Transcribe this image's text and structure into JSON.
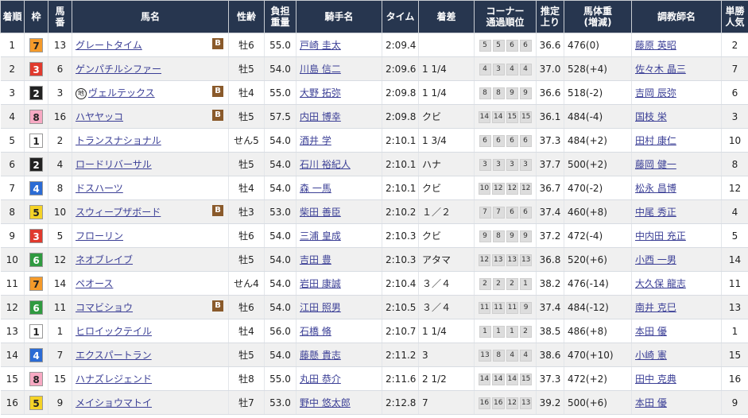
{
  "headers": {
    "rank": "着順",
    "waku": "枠",
    "umaban": "馬\n番",
    "horse": "馬名",
    "sexage": "性齢",
    "kinryo": "負担\n重量",
    "jockey": "騎手名",
    "time": "タイム",
    "margin": "着差",
    "corner": "コーナー\n通過順位",
    "last3f": "推定\n上り",
    "weight": "馬体重\n(増減)",
    "trainer": "調教師名",
    "pop": "単勝\n人気"
  },
  "waku_colors": {
    "1": {
      "bg": "#ffffff",
      "fg": "#222222"
    },
    "2": {
      "bg": "#222222",
      "fg": "#ffffff"
    },
    "3": {
      "bg": "#e03a2e",
      "fg": "#ffffff"
    },
    "4": {
      "bg": "#2b6bd4",
      "fg": "#ffffff"
    },
    "5": {
      "bg": "#f5d327",
      "fg": "#222222"
    },
    "6": {
      "bg": "#2f9a40",
      "fg": "#ffffff"
    },
    "7": {
      "bg": "#f49a2a",
      "fg": "#222222"
    },
    "8": {
      "bg": "#f7a9c3",
      "fg": "#222222"
    }
  },
  "blinker_label": "B",
  "mark_label": "地",
  "rows": [
    {
      "rank": "1",
      "waku": "7",
      "umaban": "13",
      "horse": "グレートタイム",
      "blinker": true,
      "mark": false,
      "sexage": "牡6",
      "kinryo": "55.0",
      "jockey": "戸崎 圭太",
      "time": "2:09.4",
      "margin": "",
      "corner": [
        "5",
        "5",
        "6",
        "6"
      ],
      "last3f": "36.6",
      "weight": "476(0)",
      "trainer": "藤原 英昭",
      "pop": "2"
    },
    {
      "rank": "2",
      "waku": "3",
      "umaban": "6",
      "horse": "ゲンパチルシファー",
      "blinker": false,
      "mark": false,
      "sexage": "牡5",
      "kinryo": "54.0",
      "jockey": "川島 信二",
      "time": "2:09.6",
      "margin": "1 1/4",
      "corner": [
        "4",
        "3",
        "4",
        "4"
      ],
      "last3f": "37.0",
      "weight": "528(+4)",
      "trainer": "佐々木 晶三",
      "pop": "7"
    },
    {
      "rank": "3",
      "waku": "2",
      "umaban": "3",
      "horse": "ヴェルテックス",
      "blinker": true,
      "mark": true,
      "sexage": "牡4",
      "kinryo": "55.0",
      "jockey": "大野 拓弥",
      "time": "2:09.8",
      "margin": "1 1/4",
      "corner": [
        "8",
        "8",
        "9",
        "9"
      ],
      "last3f": "36.6",
      "weight": "518(-2)",
      "trainer": "吉岡 辰弥",
      "pop": "6"
    },
    {
      "rank": "4",
      "waku": "8",
      "umaban": "16",
      "horse": "ハヤヤッコ",
      "blinker": true,
      "mark": false,
      "sexage": "牡5",
      "kinryo": "57.5",
      "jockey": "内田 博幸",
      "time": "2:09.8",
      "margin": "クビ",
      "corner": [
        "14",
        "14",
        "15",
        "15"
      ],
      "last3f": "36.1",
      "weight": "484(-4)",
      "trainer": "国枝 栄",
      "pop": "3"
    },
    {
      "rank": "5",
      "waku": "1",
      "umaban": "2",
      "horse": "トランスナショナル",
      "blinker": false,
      "mark": false,
      "sexage": "せん5",
      "kinryo": "54.0",
      "jockey": "酒井 学",
      "time": "2:10.1",
      "margin": "1 3/4",
      "corner": [
        "6",
        "6",
        "6",
        "6"
      ],
      "last3f": "37.3",
      "weight": "484(+2)",
      "trainer": "田村 康仁",
      "pop": "10"
    },
    {
      "rank": "6",
      "waku": "2",
      "umaban": "4",
      "horse": "ロードリバーサル",
      "blinker": false,
      "mark": false,
      "sexage": "牡5",
      "kinryo": "54.0",
      "jockey": "石川 裕紀人",
      "time": "2:10.1",
      "margin": "ハナ",
      "corner": [
        "3",
        "3",
        "3",
        "3"
      ],
      "last3f": "37.7",
      "weight": "500(+2)",
      "trainer": "藤岡 健一",
      "pop": "8"
    },
    {
      "rank": "7",
      "waku": "4",
      "umaban": "8",
      "horse": "ドスハーツ",
      "blinker": false,
      "mark": false,
      "sexage": "牡4",
      "kinryo": "54.0",
      "jockey": "森 一馬",
      "time": "2:10.1",
      "margin": "クビ",
      "corner": [
        "10",
        "12",
        "12",
        "12"
      ],
      "last3f": "36.7",
      "weight": "470(-2)",
      "trainer": "松永 昌博",
      "pop": "12"
    },
    {
      "rank": "8",
      "waku": "5",
      "umaban": "10",
      "horse": "スウィープザボード",
      "blinker": true,
      "mark": false,
      "sexage": "牡3",
      "kinryo": "53.0",
      "jockey": "柴田 善臣",
      "time": "2:10.2",
      "margin": "１／２",
      "corner": [
        "7",
        "7",
        "6",
        "6"
      ],
      "last3f": "37.4",
      "weight": "460(+8)",
      "trainer": "中尾 秀正",
      "pop": "4"
    },
    {
      "rank": "9",
      "waku": "3",
      "umaban": "5",
      "horse": "フローリン",
      "blinker": false,
      "mark": false,
      "sexage": "牡6",
      "kinryo": "54.0",
      "jockey": "三浦 皇成",
      "time": "2:10.3",
      "margin": "クビ",
      "corner": [
        "9",
        "8",
        "9",
        "9"
      ],
      "last3f": "37.2",
      "weight": "472(-4)",
      "trainer": "中内田 充正",
      "pop": "5"
    },
    {
      "rank": "10",
      "waku": "6",
      "umaban": "12",
      "horse": "ネオブレイブ",
      "blinker": false,
      "mark": false,
      "sexage": "牡5",
      "kinryo": "54.0",
      "jockey": "吉田 豊",
      "time": "2:10.3",
      "margin": "アタマ",
      "corner": [
        "12",
        "13",
        "13",
        "13"
      ],
      "last3f": "36.8",
      "weight": "520(+6)",
      "trainer": "小西 一男",
      "pop": "14"
    },
    {
      "rank": "11",
      "waku": "7",
      "umaban": "14",
      "horse": "ペオース",
      "blinker": false,
      "mark": false,
      "sexage": "せん4",
      "kinryo": "54.0",
      "jockey": "岩田 康誠",
      "time": "2:10.4",
      "margin": "３／４",
      "corner": [
        "2",
        "2",
        "2",
        "1"
      ],
      "last3f": "38.2",
      "weight": "476(-14)",
      "trainer": "大久保 龍志",
      "pop": "11"
    },
    {
      "rank": "12",
      "waku": "6",
      "umaban": "11",
      "horse": "コマビショウ",
      "blinker": true,
      "mark": false,
      "sexage": "牡6",
      "kinryo": "54.0",
      "jockey": "江田 照男",
      "time": "2:10.5",
      "margin": "３／４",
      "corner": [
        "11",
        "11",
        "11",
        "9"
      ],
      "last3f": "37.4",
      "weight": "484(-12)",
      "trainer": "南井 克巳",
      "pop": "13"
    },
    {
      "rank": "13",
      "waku": "1",
      "umaban": "1",
      "horse": "ヒロイックテイル",
      "blinker": false,
      "mark": false,
      "sexage": "牡4",
      "kinryo": "56.0",
      "jockey": "石橋 脩",
      "time": "2:10.7",
      "margin": "1 1/4",
      "corner": [
        "1",
        "1",
        "1",
        "2"
      ],
      "last3f": "38.5",
      "weight": "486(+8)",
      "trainer": "本田 優",
      "pop": "1"
    },
    {
      "rank": "14",
      "waku": "4",
      "umaban": "7",
      "horse": "エクスパートラン",
      "blinker": false,
      "mark": false,
      "sexage": "牡5",
      "kinryo": "54.0",
      "jockey": "藤懸 貴志",
      "time": "2:11.2",
      "margin": "3",
      "corner": [
        "13",
        "8",
        "4",
        "4"
      ],
      "last3f": "38.6",
      "weight": "470(+10)",
      "trainer": "小崎 憲",
      "pop": "15"
    },
    {
      "rank": "15",
      "waku": "8",
      "umaban": "15",
      "horse": "ハナズレジェンド",
      "blinker": false,
      "mark": false,
      "sexage": "牡8",
      "kinryo": "55.0",
      "jockey": "丸田 恭介",
      "time": "2:11.6",
      "margin": "2 1/2",
      "corner": [
        "14",
        "14",
        "14",
        "15"
      ],
      "last3f": "37.3",
      "weight": "472(+2)",
      "trainer": "田中 克典",
      "pop": "16"
    },
    {
      "rank": "16",
      "waku": "5",
      "umaban": "9",
      "horse": "メイショウマトイ",
      "blinker": false,
      "mark": false,
      "sexage": "牡7",
      "kinryo": "53.0",
      "jockey": "野中 悠太郎",
      "time": "2:12.8",
      "margin": "7",
      "corner": [
        "16",
        "16",
        "12",
        "13"
      ],
      "last3f": "39.2",
      "weight": "500(+6)",
      "trainer": "本田 優",
      "pop": "9"
    }
  ]
}
